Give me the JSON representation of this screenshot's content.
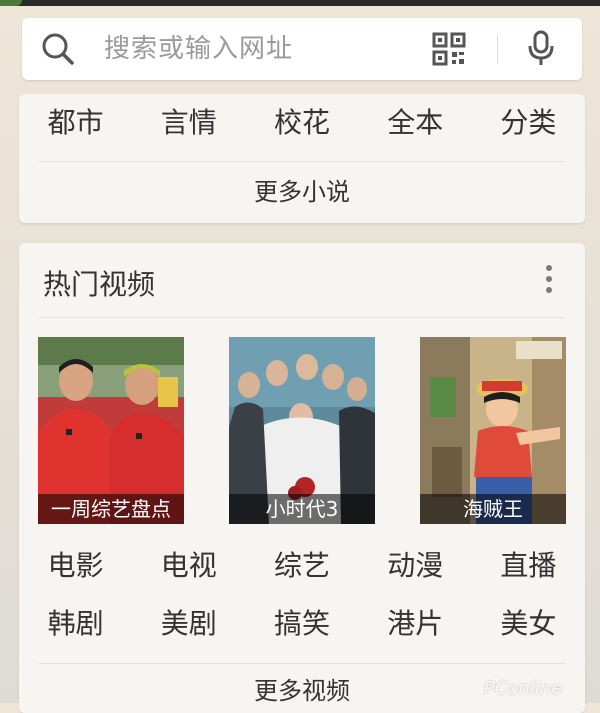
{
  "search": {
    "placeholder": "搜索或输入网址"
  },
  "icons": {
    "search": "search-icon",
    "qr": "qr-code-icon",
    "mic": "microphone-icon",
    "more": "more-vertical-icon"
  },
  "novels": {
    "categories": [
      "都市",
      "言情",
      "校花",
      "全本",
      "分类"
    ],
    "more_label": "更多小说"
  },
  "videos": {
    "title": "热门视频",
    "thumbnails": [
      {
        "caption": "一周综艺盘点"
      },
      {
        "caption": "小时代3"
      },
      {
        "caption": "海贼王"
      }
    ],
    "categories_row1": [
      "电影",
      "电视",
      "综艺",
      "动漫",
      "直播"
    ],
    "categories_row2": [
      "韩剧",
      "美剧",
      "搞笑",
      "港片",
      "美女"
    ],
    "more_label": "更多视频"
  },
  "watermark": "PConline",
  "colors": {
    "card_bg": "#f7f5f2",
    "text": "#333333",
    "placeholder": "#9a9a9a",
    "icon": "#555555"
  }
}
